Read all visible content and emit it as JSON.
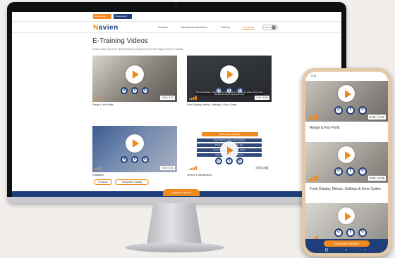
{
  "top_buttons": {
    "first": "Homeowner",
    "second": "Professional"
  },
  "brand": {
    "logo_text_accent": "N",
    "logo_text": "avien"
  },
  "nav": [
    {
      "label": "Products"
    },
    {
      "label": "Manuals and Brochures"
    },
    {
      "label": "Training"
    },
    {
      "label": "E-Training"
    }
  ],
  "search": {
    "placeholder": "Search"
  },
  "page": {
    "title": "E-Training Videos",
    "description": "Please watch all of the videos below to progress to the next stage of the E-Training."
  },
  "videos": [
    {
      "caption": "Range & Key Parts",
      "time": "0:00 / 2:22"
    },
    {
      "caption": "Front Display, Menus, Settings & Error Codes",
      "time": "0:00 / 6:08",
      "subtitle": "The Front Display is where Menus, Settings & Error Codes are shown and you can see allow the user to operate the unit"
    },
    {
      "caption": "Installation",
      "time": "0:00 / 6:36"
    },
    {
      "caption": "Service & Maintenance",
      "time": "0:00 / 3:56",
      "menu_title": "Maintenance Schedule",
      "menu_items": [
        "Check the flue system and terminal",
        "Check condensate trap and pipe",
        "Check the heat exchanger for debris",
        "Verify the unit operates correctly"
      ]
    }
  ],
  "buttons": {
    "previous": "Previous",
    "complete": "Complete Training"
  },
  "footer": {
    "customer_service": "Customer Service"
  },
  "phone": {
    "status_time": "9:41",
    "videos": [
      {
        "caption": "Range & Key Parts",
        "time": "0:00 / 2:22"
      },
      {
        "caption": "Front Display, Menus, Settings & Error Codes",
        "time": "0:00 / 6:08"
      },
      {
        "caption": "",
        "time": ""
      }
    ],
    "customer_service": "Customer Service"
  },
  "colors": {
    "accent": "#f08a1c",
    "brand": "#1f3f7a"
  }
}
